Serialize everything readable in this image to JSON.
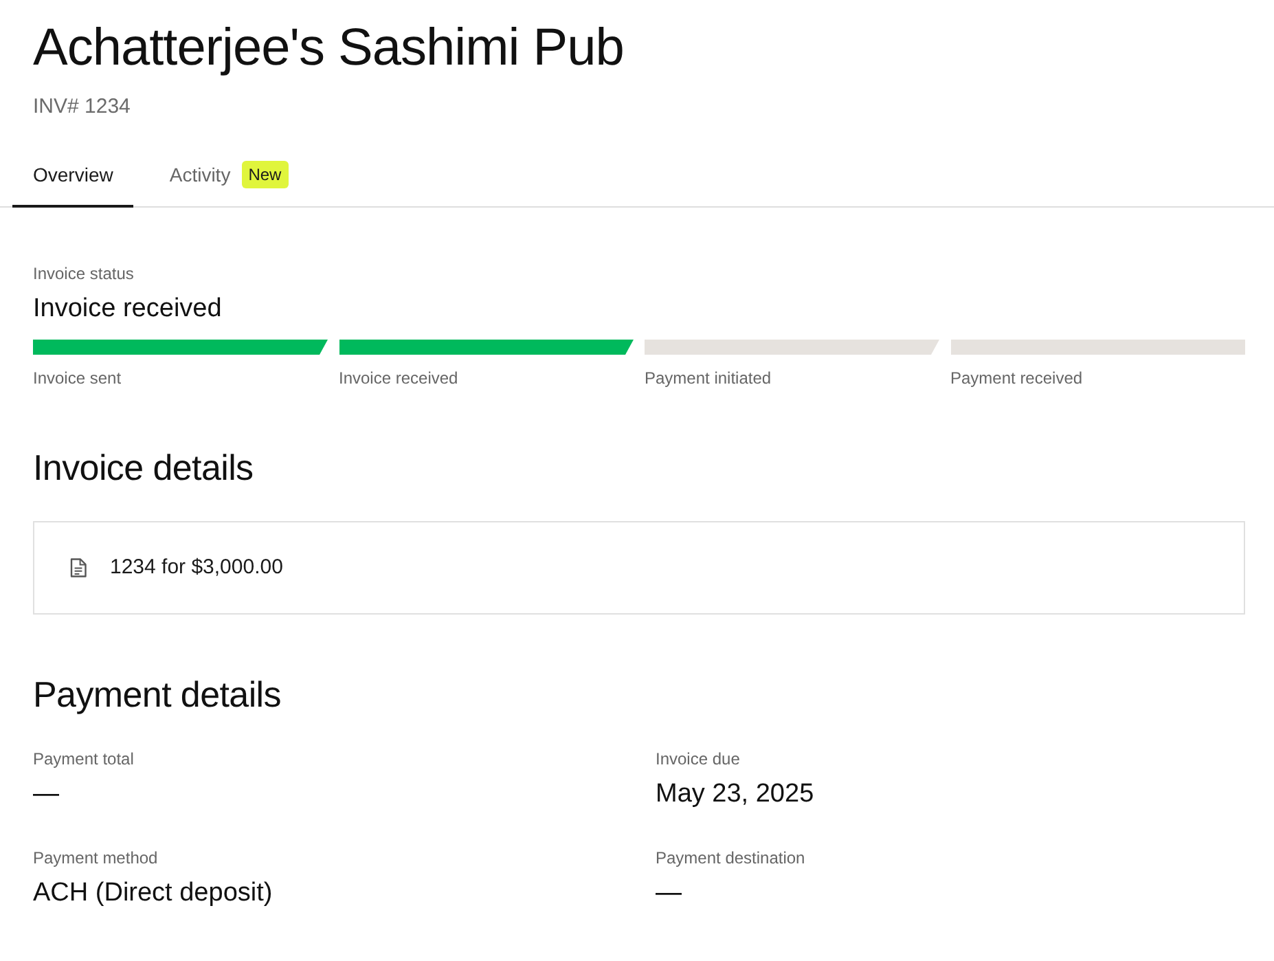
{
  "header": {
    "title": "Achatterjee's Sashimi Pub",
    "invoice_number": "INV# 1234"
  },
  "tabs": [
    {
      "label": "Overview",
      "selected": true
    },
    {
      "label": "Activity",
      "selected": false,
      "badge": "New"
    }
  ],
  "invoice_status": {
    "label": "Invoice status",
    "value": "Invoice received",
    "steps": [
      {
        "label": "Invoice sent",
        "done": true
      },
      {
        "label": "Invoice received",
        "done": true
      },
      {
        "label": "Payment initiated",
        "done": false
      },
      {
        "label": "Payment received",
        "done": false
      }
    ]
  },
  "invoice_details": {
    "heading": "Invoice details",
    "items": [
      {
        "text": "1234 for $3,000.00"
      }
    ]
  },
  "payment_details": {
    "heading": "Payment details",
    "fields": [
      {
        "label": "Payment total",
        "value": "—"
      },
      {
        "label": "Invoice due",
        "value": "May 23, 2025"
      },
      {
        "label": "Payment method",
        "value": "ACH (Direct deposit)"
      },
      {
        "label": "Payment destination",
        "value": "—"
      }
    ]
  }
}
